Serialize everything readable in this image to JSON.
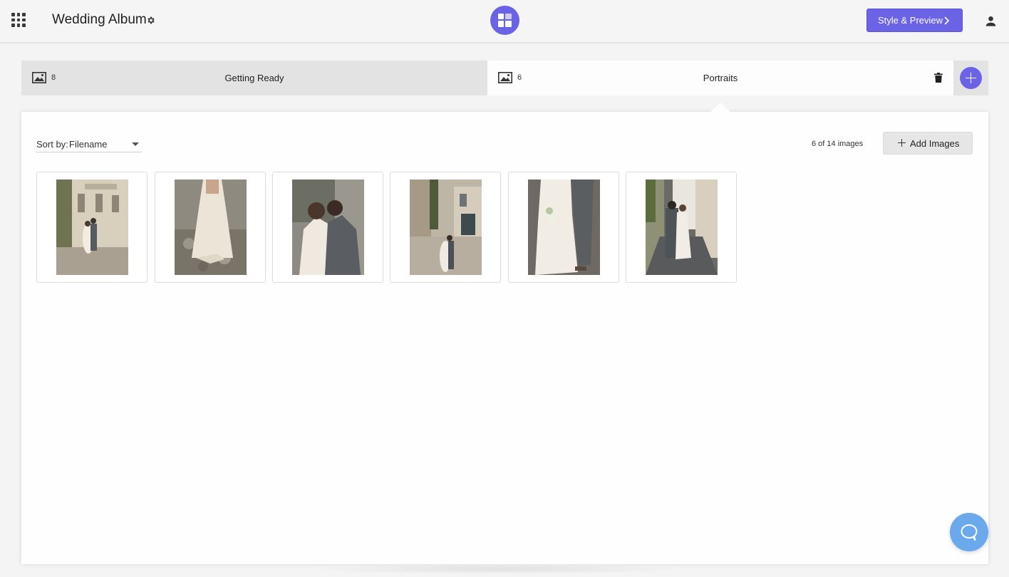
{
  "header": {
    "album_title": "Wedding Album",
    "style_preview_label": "Style & Preview",
    "icons": [
      "apps-grid-icon",
      "gear-icon",
      "app-logo-icon",
      "chevron-right-icon",
      "user-icon"
    ]
  },
  "sections": [
    {
      "count": "8",
      "name": "Getting Ready",
      "active": false
    },
    {
      "count": "6",
      "name": "Portraits",
      "active": true
    }
  ],
  "toolbar": {
    "sort_label": "Sort by:",
    "sort_value": "Filename",
    "image_count": "6 of 14 images",
    "add_images_label": "Add Images"
  },
  "thumbnails": [
    {
      "subject": "couple-in-front-of-stone-building"
    },
    {
      "subject": "bride-walking-on-cobblestones"
    },
    {
      "subject": "couple-kissing-closeup"
    },
    {
      "subject": "couple-in-village-square"
    },
    {
      "subject": "bride-holding-bouquet-with-groom"
    },
    {
      "subject": "couple-walking-down-street"
    }
  ],
  "colors": {
    "accent": "#6b63e6",
    "chat": "#6aa9ec",
    "active_tab": "#fdfdfd",
    "inactive_tab": "#e3e3e3"
  }
}
